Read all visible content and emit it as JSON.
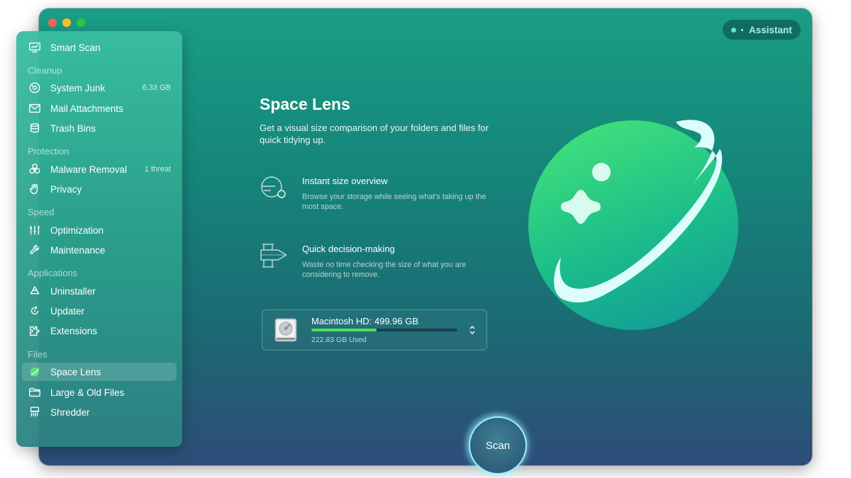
{
  "assistant": {
    "label": "Assistant"
  },
  "sidebar": {
    "smart_scan": {
      "label": "Smart Scan",
      "icon": "monitor-icon"
    },
    "sections": [
      {
        "title": "Cleanup",
        "items": [
          {
            "label": "System Junk",
            "badge": "6.33 GB",
            "icon": "disc-icon"
          },
          {
            "label": "Mail Attachments",
            "badge": "",
            "icon": "envelope-icon"
          },
          {
            "label": "Trash Bins",
            "badge": "",
            "icon": "trash-icon"
          }
        ]
      },
      {
        "title": "Protection",
        "items": [
          {
            "label": "Malware Removal",
            "badge": "1 threat",
            "icon": "biohazard-icon"
          },
          {
            "label": "Privacy",
            "badge": "",
            "icon": "hand-icon"
          }
        ]
      },
      {
        "title": "Speed",
        "items": [
          {
            "label": "Optimization",
            "badge": "",
            "icon": "sliders-icon"
          },
          {
            "label": "Maintenance",
            "badge": "",
            "icon": "wrench-icon"
          }
        ]
      },
      {
        "title": "Applications",
        "items": [
          {
            "label": "Uninstaller",
            "badge": "",
            "icon": "app-store-icon"
          },
          {
            "label": "Updater",
            "badge": "",
            "icon": "refresh-arrow-icon"
          },
          {
            "label": "Extensions",
            "badge": "",
            "icon": "puzzle-icon"
          }
        ]
      },
      {
        "title": "Files",
        "items": [
          {
            "label": "Space Lens",
            "badge": "",
            "icon": "planet-icon",
            "active": true
          },
          {
            "label": "Large & Old Files",
            "badge": "",
            "icon": "folder-icon"
          },
          {
            "label": "Shredder",
            "badge": "",
            "icon": "shredder-icon"
          }
        ]
      }
    ]
  },
  "main": {
    "title": "Space Lens",
    "subtitle": "Get a visual size comparison of your folders and files for quick tidying up.",
    "features": [
      {
        "title": "Instant size overview",
        "description": "Browse your storage while seeing what's taking up the most space.",
        "icon": "magnifier-globe-icon"
      },
      {
        "title": "Quick decision-making",
        "description": "Waste no time checking the size of what you are considering to remove.",
        "icon": "decision-icon"
      }
    ],
    "disk": {
      "name": "Macintosh HD: 499.96 GB",
      "used": "222.83 GB Used",
      "used_fraction": 0.4457,
      "icon": "hard-drive-icon"
    },
    "scan_label": "Scan"
  },
  "colors": {
    "accent_green": "#4fe25e",
    "window_top": "#1a9e85",
    "window_bottom": "#2d4d78",
    "scan_ring": "#9ff0ff"
  }
}
